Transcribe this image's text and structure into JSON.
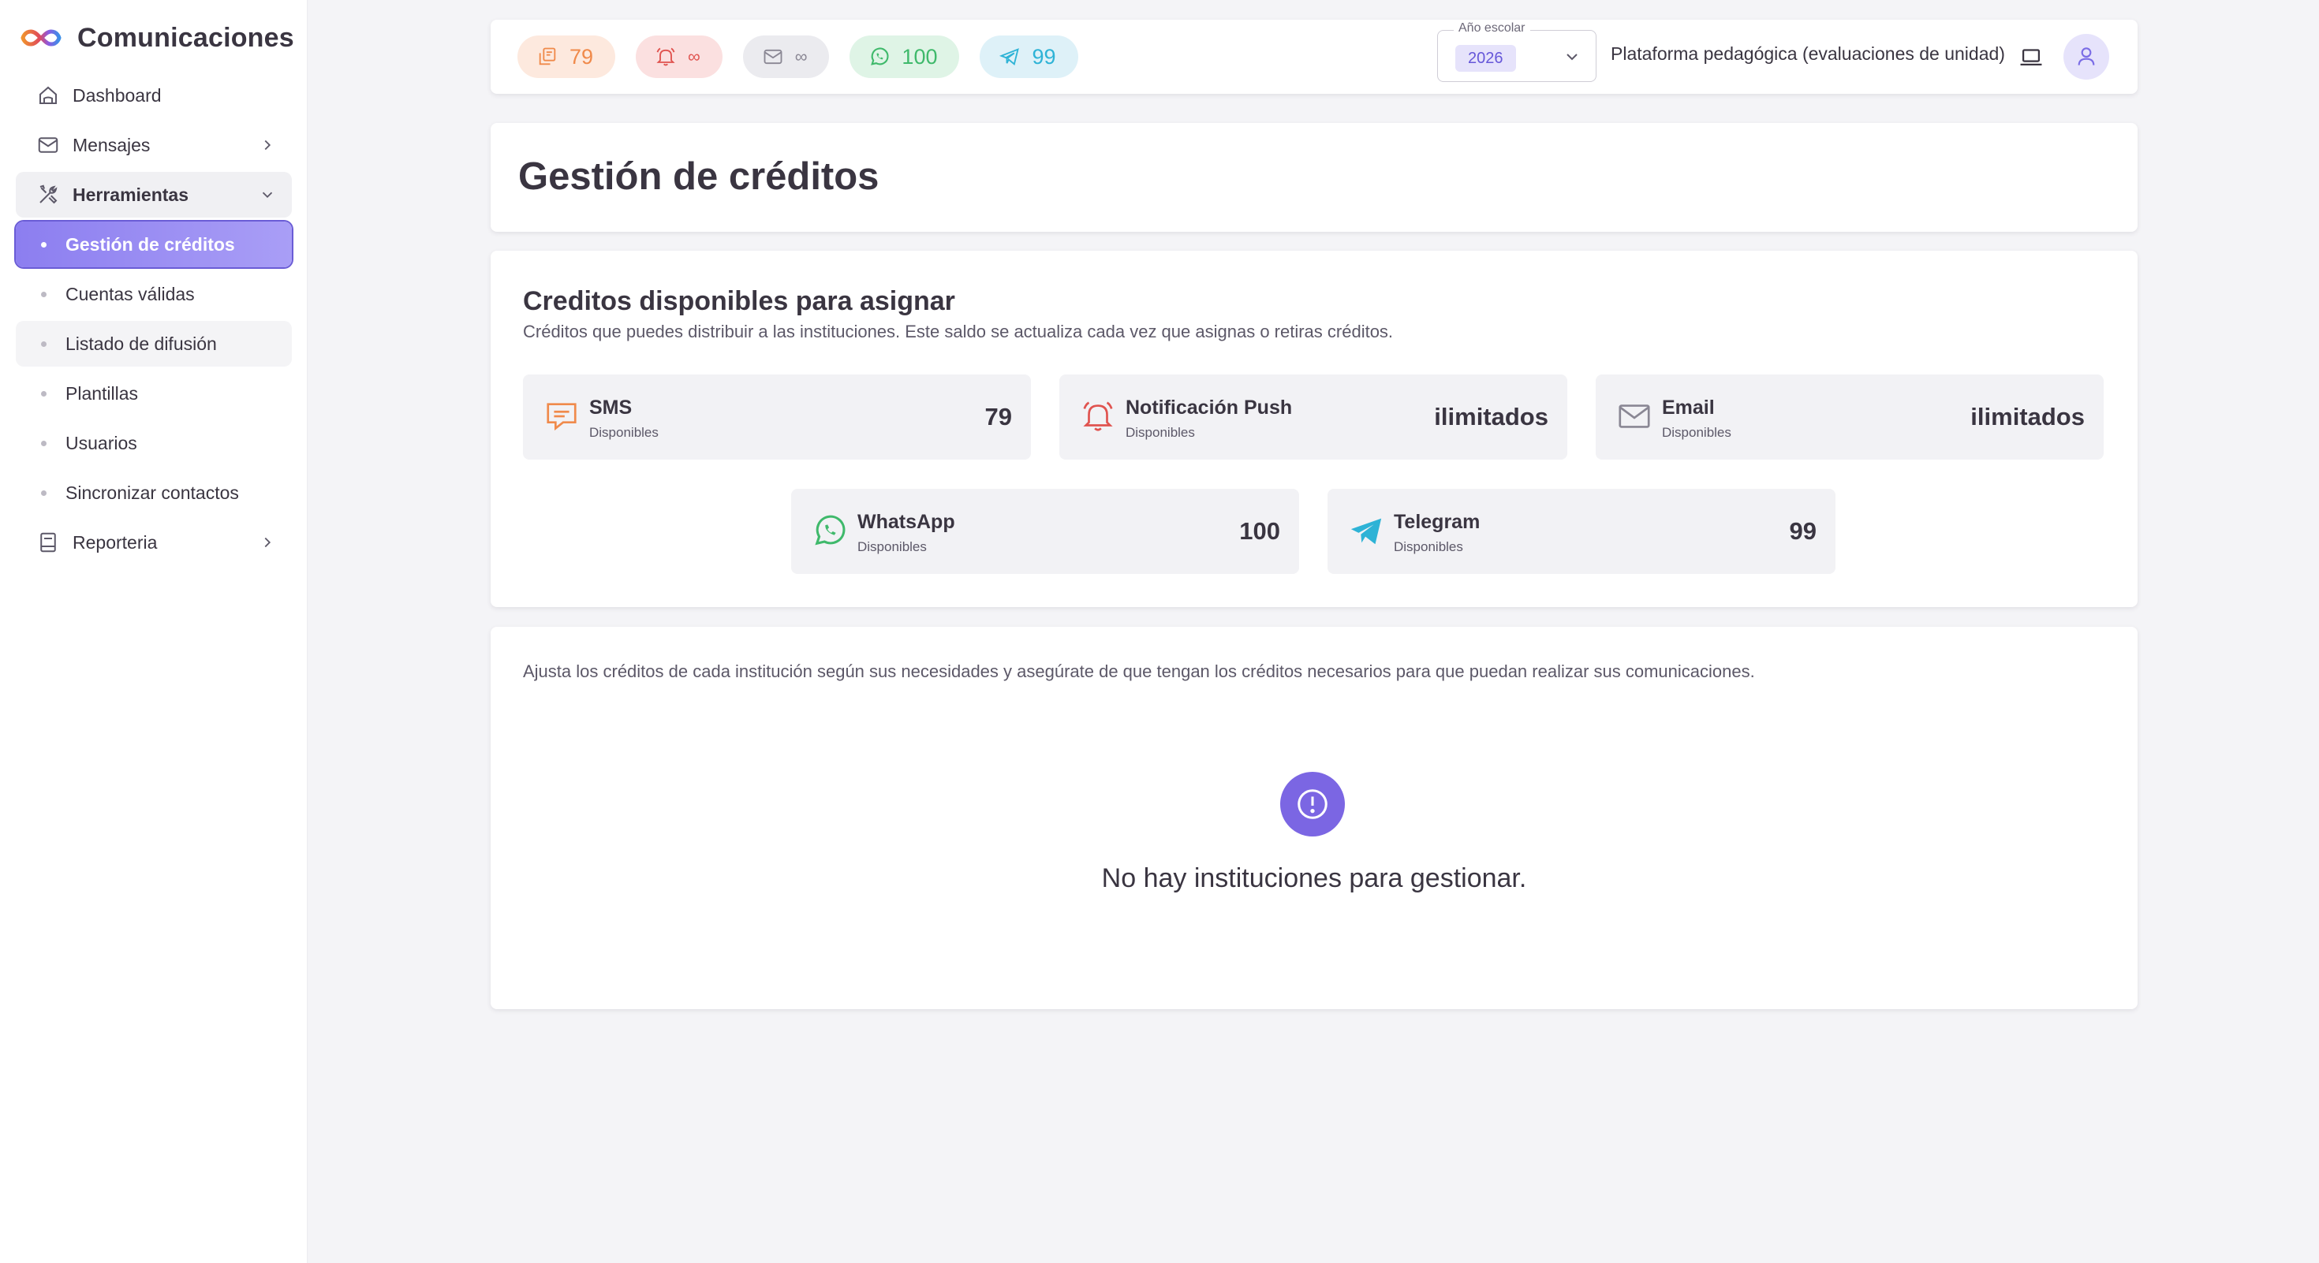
{
  "app": {
    "title": "Comunicaciones"
  },
  "sidebar": {
    "items": [
      {
        "label": "Dashboard"
      },
      {
        "label": "Mensajes"
      },
      {
        "label": "Herramientas"
      },
      {
        "label": "Gestión de créditos"
      },
      {
        "label": "Cuentas válidas"
      },
      {
        "label": "Listado de difusión"
      },
      {
        "label": "Plantillas"
      },
      {
        "label": "Usuarios"
      },
      {
        "label": "Sincronizar contactos"
      },
      {
        "label": "Reporteria"
      }
    ]
  },
  "topbar": {
    "pills": {
      "sms": "79",
      "push": "∞",
      "email": "∞",
      "whatsapp": "100",
      "telegram": "99"
    },
    "year": {
      "label": "Año escolar",
      "value": "2026"
    },
    "platform": "Plataforma pedagógica (evaluaciones de unidad)"
  },
  "page": {
    "title": "Gestión de créditos"
  },
  "credits": {
    "title": "Creditos disponibles para asignar",
    "subtitle": "Créditos que puedes distribuir a las instituciones. Este saldo se actualiza cada vez que asignas o retiras créditos.",
    "tiles": [
      {
        "name": "SMS",
        "sub": "Disponibles",
        "value": "79"
      },
      {
        "name": "Notificación Push",
        "sub": "Disponibles",
        "value": "ilimitados"
      },
      {
        "name": "Email",
        "sub": "Disponibles",
        "value": "ilimitados"
      },
      {
        "name": "WhatsApp",
        "sub": "Disponibles",
        "value": "100"
      },
      {
        "name": "Telegram",
        "sub": "Disponibles",
        "value": "99"
      }
    ]
  },
  "institutions": {
    "description": "Ajusta los créditos de cada institución según sus necesidades y asegúrate de que tengan los créditos necesarios para que puedan realizar sus comunicaciones.",
    "empty_message": "No hay instituciones para gestionar."
  },
  "colors": {
    "accent": "#7b66e3",
    "sms": "#f08a4b",
    "push": "#e0534f",
    "email": "#8a8794",
    "whatsapp": "#3fb96b",
    "telegram": "#2eb3d6"
  }
}
